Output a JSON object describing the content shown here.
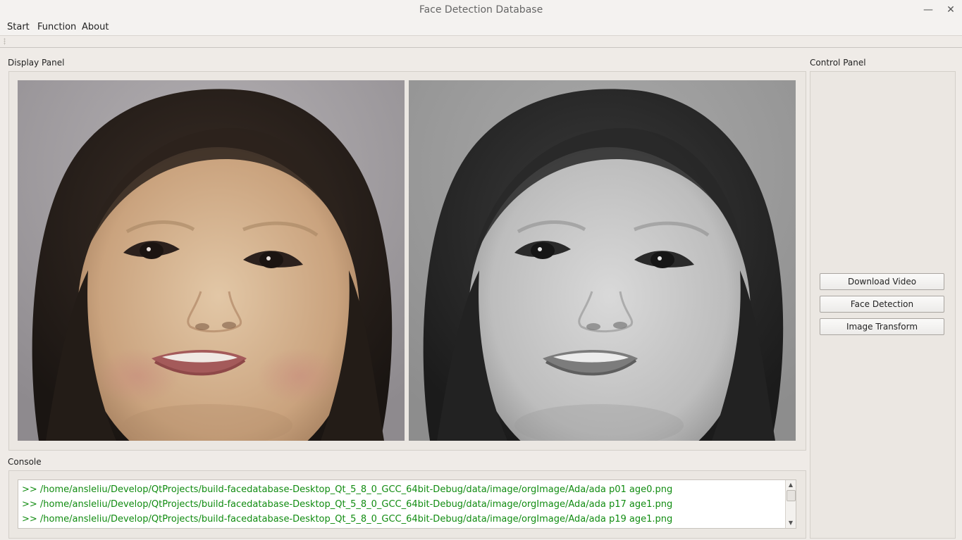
{
  "window": {
    "title": "Face Detection Database",
    "minimize_icon": "minimize-icon",
    "close_icon": "close-icon"
  },
  "menu": {
    "items": [
      "Start",
      "Function",
      "About"
    ]
  },
  "display_panel": {
    "label": "Display Panel",
    "images": [
      {
        "name": "original-face-image",
        "mode": "color"
      },
      {
        "name": "grayscale-face-image",
        "mode": "grayscale"
      }
    ]
  },
  "control_panel": {
    "label": "Control Panel",
    "buttons": [
      "Download Video",
      "Face Detection",
      "Image Transform"
    ]
  },
  "console": {
    "label": "Console",
    "text_color": "#118c11",
    "lines": [
      ">> /home/ansleliu/Develop/QtProjects/build-facedatabase-Desktop_Qt_5_8_0_GCC_64bit-Debug/data/image/orgImage/Ada/ada p01 age0.png",
      ">> /home/ansleliu/Develop/QtProjects/build-facedatabase-Desktop_Qt_5_8_0_GCC_64bit-Debug/data/image/orgImage/Ada/ada p17 age1.png",
      ">> /home/ansleliu/Develop/QtProjects/build-facedatabase-Desktop_Qt_5_8_0_GCC_64bit-Debug/data/image/orgImage/Ada/ada p19 age1.png"
    ]
  }
}
